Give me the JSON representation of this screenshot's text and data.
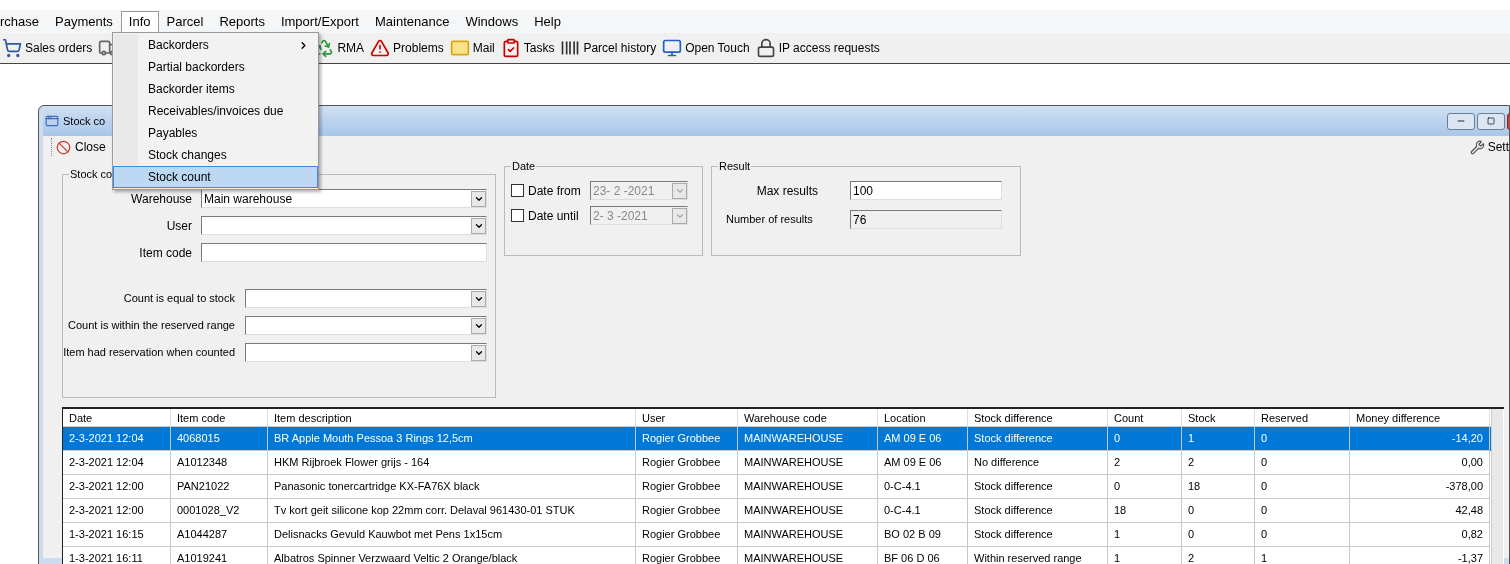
{
  "menu_bar": [
    {
      "label": "rchase",
      "open": false
    },
    {
      "label": "Payments",
      "open": false
    },
    {
      "label": "Info",
      "open": true
    },
    {
      "label": "Parcel",
      "open": false
    },
    {
      "label": "Reports",
      "open": false
    },
    {
      "label": "Import/Export",
      "open": false
    },
    {
      "label": "Maintenance",
      "open": false
    },
    {
      "label": "Windows",
      "open": false
    },
    {
      "label": "Help",
      "open": false
    }
  ],
  "toolbar": [
    {
      "kind": "cart",
      "label": "Sales orders"
    },
    {
      "kind": "truck"
    },
    {
      "kind": "recycle",
      "label": "RMA"
    },
    {
      "kind": "warning",
      "label": "Problems"
    },
    {
      "kind": "mail",
      "label": "Mail"
    },
    {
      "kind": "tasks",
      "label": "Tasks"
    },
    {
      "kind": "barcode",
      "label": "Parcel history"
    },
    {
      "kind": "monitor",
      "label": "Open Touch"
    },
    {
      "kind": "lock",
      "label": "IP access requests"
    }
  ],
  "info_menu": [
    {
      "label": "Backorders",
      "submenu": true,
      "selected": false
    },
    {
      "label": "Partial backorders",
      "submenu": false,
      "selected": false
    },
    {
      "label": "Backorder items",
      "submenu": false,
      "selected": false
    },
    {
      "label": "Receivables/invoices due",
      "submenu": false,
      "selected": false
    },
    {
      "label": "Payables",
      "submenu": false,
      "selected": false
    },
    {
      "label": "Stock changes",
      "submenu": false,
      "selected": false
    },
    {
      "label": "Stock count",
      "submenu": false,
      "selected": true
    }
  ],
  "window": {
    "title": "Stock co",
    "close_label": "Close",
    "settings_label": "Sett"
  },
  "filter_group": {
    "title": "Stock co",
    "fields": [
      {
        "kind": "combo",
        "label": "Warehouse",
        "value": "Main warehouse"
      },
      {
        "kind": "combo",
        "label": "User"
      },
      {
        "kind": "text",
        "label": "Item code"
      }
    ],
    "options": [
      {
        "label": "Count is equal to stock"
      },
      {
        "label": "Count is within the reserved range"
      },
      {
        "label": "Item had reservation when counted"
      }
    ]
  },
  "date_group": {
    "title": "Date",
    "rows": [
      {
        "label": "Date from",
        "checked": false,
        "value": "23- 2 -2021"
      },
      {
        "label": "Date until",
        "checked": false,
        "value": "2- 3 -2021"
      }
    ]
  },
  "result_group": {
    "title": "Result",
    "max_results": {
      "label": "Max results",
      "value": "100"
    },
    "number_of_results": {
      "label": "Number of results",
      "value": "76"
    }
  },
  "table": {
    "columns": [
      "Date",
      "Item code",
      "Item description",
      "User",
      "Warehouse code",
      "Location",
      "Stock difference",
      "Count",
      "Stock",
      "Reserved",
      "Money difference"
    ],
    "rows": [
      {
        "selected": true,
        "cells": [
          "2-3-2021 12:04",
          "4068015",
          "BR Apple Mouth Pessoa 3 Rings 12,5cm",
          "Rogier Grobbee",
          "MAINWAREHOUSE",
          "AM 09 E 06",
          "Stock difference",
          "0",
          "1",
          "0",
          "-14,20"
        ]
      },
      {
        "selected": false,
        "cells": [
          "2-3-2021 12:04",
          "A1012348",
          "HKM Rijbroek Flower grijs - 164",
          "Rogier Grobbee",
          "MAINWAREHOUSE",
          "AM 09 E 06",
          "No difference",
          "2",
          "2",
          "0",
          "0,00"
        ]
      },
      {
        "selected": false,
        "cells": [
          "2-3-2021 12:00",
          "PAN21022",
          "Panasonic tonercartridge KX-FA76X black",
          "Rogier Grobbee",
          "MAINWAREHOUSE",
          "0-C-4.1",
          "Stock difference",
          "0",
          "18",
          "0",
          "-378,00"
        ]
      },
      {
        "selected": false,
        "cells": [
          "2-3-2021 12:00",
          "0001028_V2",
          "Tv kort geit silicone kop 22mm corr. Delaval 961430-01 STUK",
          "Rogier Grobbee",
          "MAINWAREHOUSE",
          "0-C-4.1",
          "Stock difference",
          "18",
          "0",
          "0",
          "42,48"
        ]
      },
      {
        "selected": false,
        "cells": [
          "1-3-2021 16:15",
          "A1044287",
          "Delisnacks Gevuld Kauwbot met Pens 1x15cm",
          "Rogier Grobbee",
          "MAINWAREHOUSE",
          "BO 02 B 09",
          "Stock difference",
          "1",
          "0",
          "0",
          "0,82"
        ]
      },
      {
        "selected": false,
        "cells": [
          "1-3-2021 16:11",
          "A1019241",
          "Albatros Spinner Verzwaard Veltic 2 Orange/black",
          "Rogier Grobbee",
          "MAINWAREHOUSE",
          "BF 06 D 06",
          "Within reserved range",
          "1",
          "2",
          "1",
          "-1,37"
        ]
      }
    ]
  }
}
